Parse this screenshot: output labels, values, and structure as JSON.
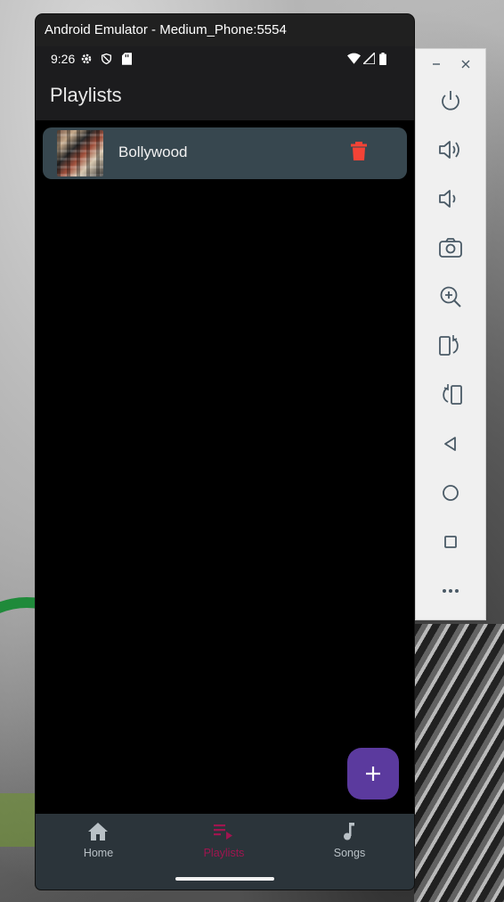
{
  "window": {
    "title": "Android Emulator - Medium_Phone:5554"
  },
  "status_bar": {
    "time": "9:26",
    "icons": [
      "settings-icon",
      "shield-icon",
      "sd-card-icon",
      "wifi-icon",
      "signal-icon",
      "battery-icon"
    ]
  },
  "app_bar": {
    "title": "Playlists"
  },
  "playlists": [
    {
      "name": "Bollywood"
    }
  ],
  "fab": {
    "icon": "plus-icon"
  },
  "bottom_nav": {
    "items": [
      {
        "label": "Home",
        "icon": "home-icon",
        "active": false
      },
      {
        "label": "Playlists",
        "icon": "playlist-icon",
        "active": true
      },
      {
        "label": "Songs",
        "icon": "music-note-icon",
        "active": false
      }
    ]
  },
  "emulator_toolbar": {
    "buttons": [
      "power-icon",
      "volume-up-icon",
      "volume-down-icon",
      "camera-icon",
      "zoom-in-icon",
      "rotate-left-icon",
      "rotate-right-icon",
      "back-icon",
      "home-circle-icon",
      "overview-icon",
      "more-icon"
    ]
  },
  "colors": {
    "accent": "#a0154f",
    "fab": "#5b3a9e",
    "card": "#37474f",
    "delete": "#f44336",
    "nav_bg": "#2b343a"
  }
}
